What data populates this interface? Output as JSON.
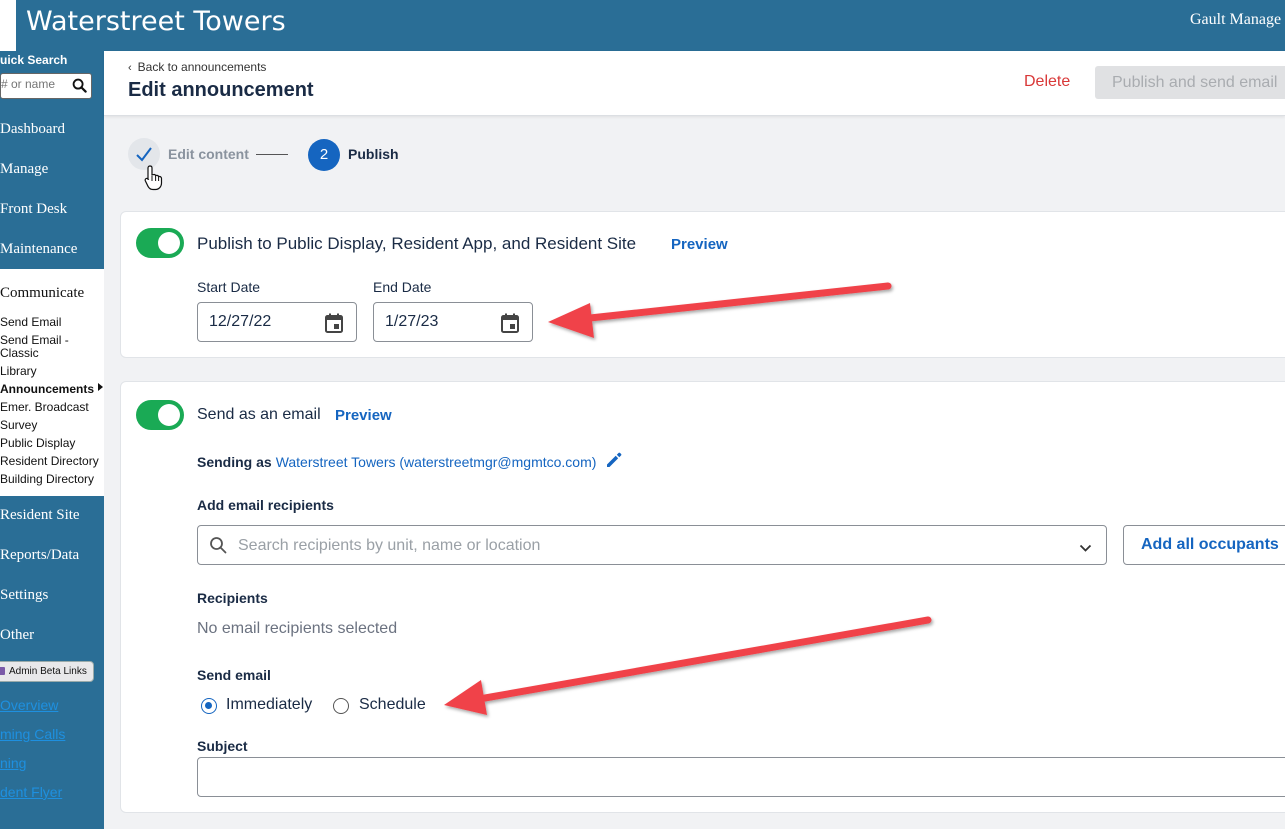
{
  "header": {
    "app_title": "Waterstreet Towers",
    "user_name": "Gault Manage"
  },
  "sidebar": {
    "quick_search_label": "uick Search",
    "quick_search_placeholder": "# or name",
    "main_items": [
      "Dashboard",
      "Manage",
      "Front Desk",
      "Maintenance"
    ],
    "communicate": {
      "title": "Communicate",
      "items": [
        "Send Email",
        "Send Email -",
        "Classic",
        "Library",
        "Announcements",
        "Emer. Broadcast",
        "Survey",
        "Public Display",
        "Resident Directory",
        "Building Directory"
      ],
      "active_item": "Announcements"
    },
    "bottom_items": [
      "Resident Site",
      "Reports/Data",
      "Settings",
      "Other"
    ],
    "beta_button": "Admin Beta Links",
    "beta_links": [
      "Overview",
      "ming Calls",
      "ning",
      "dent Flyer"
    ]
  },
  "page": {
    "back_link": "Back to announcements",
    "title": "Edit announcement",
    "delete_label": "Delete",
    "publish_label": "Publish and send email"
  },
  "stepper": {
    "step1_label": "Edit content",
    "step2_number": "2",
    "step2_label": "Publish"
  },
  "publish_section": {
    "toggle_label": "Publish to Public Display, Resident App, and Resident Site",
    "preview_label": "Preview",
    "start_date_label": "Start Date",
    "start_date_value": "12/27/22",
    "end_date_label": "End Date",
    "end_date_value": "1/27/23"
  },
  "email_section": {
    "toggle_label": "Send as an email",
    "preview_label": "Preview",
    "sending_as_label": "Sending as",
    "sending_as_value": "Waterstreet Towers (waterstreetmgr@mgmtco.com)",
    "add_recipients_label": "Add email recipients",
    "search_placeholder": "Search recipients by unit, name or location",
    "add_all_label": "Add all occupants",
    "recipients_label": "Recipients",
    "recipients_empty": "No email recipients selected",
    "send_email_label": "Send email",
    "option_immediately": "Immediately",
    "option_schedule": "Schedule",
    "selected_option": "Immediately",
    "subject_label": "Subject",
    "subject_value": ""
  },
  "colors": {
    "brand": "#2a6e96",
    "accent": "#1565c0",
    "toggle_on": "#1aaa55",
    "danger": "#d93838",
    "annotation_arrow": "#f0434a"
  },
  "icons": [
    "search-icon",
    "check-icon",
    "calendar-icon",
    "pencil-icon",
    "chevron-down-icon",
    "chevron-left-icon",
    "pointer-cursor-icon",
    "annotation-arrow"
  ]
}
